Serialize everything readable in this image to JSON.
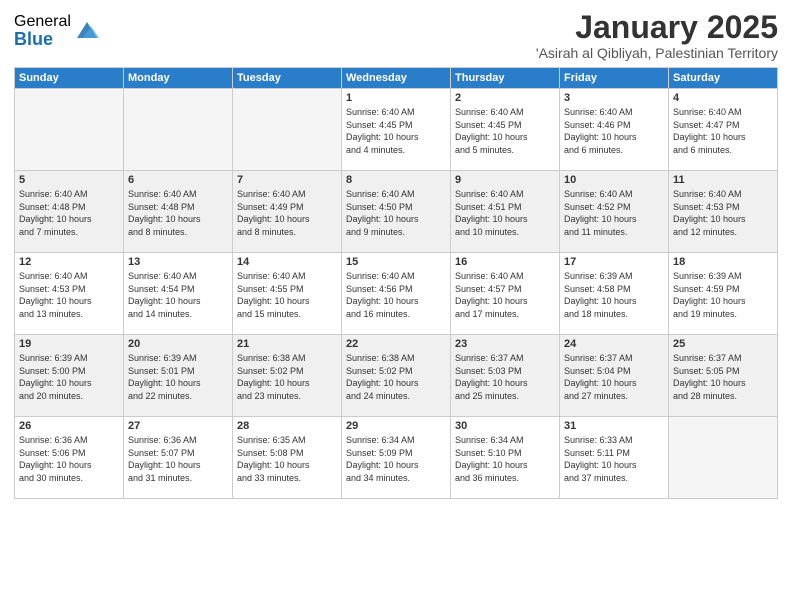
{
  "logo": {
    "general": "General",
    "blue": "Blue"
  },
  "title": "January 2025",
  "location": "'Asirah al Qibliyah, Palestinian Territory",
  "headers": [
    "Sunday",
    "Monday",
    "Tuesday",
    "Wednesday",
    "Thursday",
    "Friday",
    "Saturday"
  ],
  "weeks": [
    {
      "shade": false,
      "days": [
        {
          "num": "",
          "info": ""
        },
        {
          "num": "",
          "info": ""
        },
        {
          "num": "",
          "info": ""
        },
        {
          "num": "1",
          "info": "Sunrise: 6:40 AM\nSunset: 4:45 PM\nDaylight: 10 hours\nand 4 minutes."
        },
        {
          "num": "2",
          "info": "Sunrise: 6:40 AM\nSunset: 4:45 PM\nDaylight: 10 hours\nand 5 minutes."
        },
        {
          "num": "3",
          "info": "Sunrise: 6:40 AM\nSunset: 4:46 PM\nDaylight: 10 hours\nand 6 minutes."
        },
        {
          "num": "4",
          "info": "Sunrise: 6:40 AM\nSunset: 4:47 PM\nDaylight: 10 hours\nand 6 minutes."
        }
      ]
    },
    {
      "shade": true,
      "days": [
        {
          "num": "5",
          "info": "Sunrise: 6:40 AM\nSunset: 4:48 PM\nDaylight: 10 hours\nand 7 minutes."
        },
        {
          "num": "6",
          "info": "Sunrise: 6:40 AM\nSunset: 4:48 PM\nDaylight: 10 hours\nand 8 minutes."
        },
        {
          "num": "7",
          "info": "Sunrise: 6:40 AM\nSunset: 4:49 PM\nDaylight: 10 hours\nand 8 minutes."
        },
        {
          "num": "8",
          "info": "Sunrise: 6:40 AM\nSunset: 4:50 PM\nDaylight: 10 hours\nand 9 minutes."
        },
        {
          "num": "9",
          "info": "Sunrise: 6:40 AM\nSunset: 4:51 PM\nDaylight: 10 hours\nand 10 minutes."
        },
        {
          "num": "10",
          "info": "Sunrise: 6:40 AM\nSunset: 4:52 PM\nDaylight: 10 hours\nand 11 minutes."
        },
        {
          "num": "11",
          "info": "Sunrise: 6:40 AM\nSunset: 4:53 PM\nDaylight: 10 hours\nand 12 minutes."
        }
      ]
    },
    {
      "shade": false,
      "days": [
        {
          "num": "12",
          "info": "Sunrise: 6:40 AM\nSunset: 4:53 PM\nDaylight: 10 hours\nand 13 minutes."
        },
        {
          "num": "13",
          "info": "Sunrise: 6:40 AM\nSunset: 4:54 PM\nDaylight: 10 hours\nand 14 minutes."
        },
        {
          "num": "14",
          "info": "Sunrise: 6:40 AM\nSunset: 4:55 PM\nDaylight: 10 hours\nand 15 minutes."
        },
        {
          "num": "15",
          "info": "Sunrise: 6:40 AM\nSunset: 4:56 PM\nDaylight: 10 hours\nand 16 minutes."
        },
        {
          "num": "16",
          "info": "Sunrise: 6:40 AM\nSunset: 4:57 PM\nDaylight: 10 hours\nand 17 minutes."
        },
        {
          "num": "17",
          "info": "Sunrise: 6:39 AM\nSunset: 4:58 PM\nDaylight: 10 hours\nand 18 minutes."
        },
        {
          "num": "18",
          "info": "Sunrise: 6:39 AM\nSunset: 4:59 PM\nDaylight: 10 hours\nand 19 minutes."
        }
      ]
    },
    {
      "shade": true,
      "days": [
        {
          "num": "19",
          "info": "Sunrise: 6:39 AM\nSunset: 5:00 PM\nDaylight: 10 hours\nand 20 minutes."
        },
        {
          "num": "20",
          "info": "Sunrise: 6:39 AM\nSunset: 5:01 PM\nDaylight: 10 hours\nand 22 minutes."
        },
        {
          "num": "21",
          "info": "Sunrise: 6:38 AM\nSunset: 5:02 PM\nDaylight: 10 hours\nand 23 minutes."
        },
        {
          "num": "22",
          "info": "Sunrise: 6:38 AM\nSunset: 5:02 PM\nDaylight: 10 hours\nand 24 minutes."
        },
        {
          "num": "23",
          "info": "Sunrise: 6:37 AM\nSunset: 5:03 PM\nDaylight: 10 hours\nand 25 minutes."
        },
        {
          "num": "24",
          "info": "Sunrise: 6:37 AM\nSunset: 5:04 PM\nDaylight: 10 hours\nand 27 minutes."
        },
        {
          "num": "25",
          "info": "Sunrise: 6:37 AM\nSunset: 5:05 PM\nDaylight: 10 hours\nand 28 minutes."
        }
      ]
    },
    {
      "shade": false,
      "days": [
        {
          "num": "26",
          "info": "Sunrise: 6:36 AM\nSunset: 5:06 PM\nDaylight: 10 hours\nand 30 minutes."
        },
        {
          "num": "27",
          "info": "Sunrise: 6:36 AM\nSunset: 5:07 PM\nDaylight: 10 hours\nand 31 minutes."
        },
        {
          "num": "28",
          "info": "Sunrise: 6:35 AM\nSunset: 5:08 PM\nDaylight: 10 hours\nand 33 minutes."
        },
        {
          "num": "29",
          "info": "Sunrise: 6:34 AM\nSunset: 5:09 PM\nDaylight: 10 hours\nand 34 minutes."
        },
        {
          "num": "30",
          "info": "Sunrise: 6:34 AM\nSunset: 5:10 PM\nDaylight: 10 hours\nand 36 minutes."
        },
        {
          "num": "31",
          "info": "Sunrise: 6:33 AM\nSunset: 5:11 PM\nDaylight: 10 hours\nand 37 minutes."
        },
        {
          "num": "",
          "info": ""
        }
      ]
    }
  ]
}
